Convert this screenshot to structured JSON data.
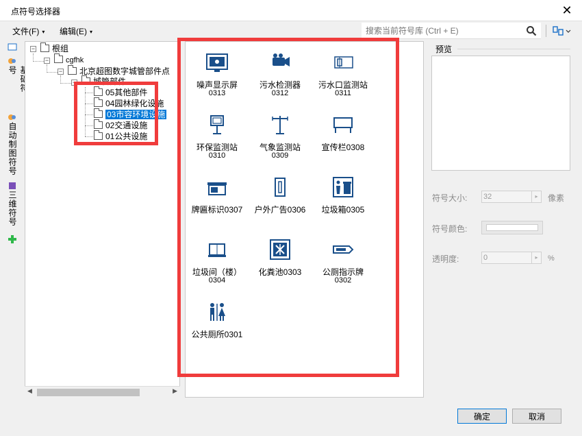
{
  "window": {
    "title": "点符号选择器",
    "close_glyph": "✕"
  },
  "menu": {
    "file": "文件(F)",
    "edit": "编辑(E)",
    "caret": "▾",
    "search_placeholder": "搜索当前符号库 (Ctrl + E)",
    "search_icon": "search-icon",
    "view_icon": "view-mode-icon"
  },
  "side_tabs": [
    {
      "label": "基础符号",
      "icon": "basic-symbol-icon"
    },
    {
      "label": "自动制图符号",
      "icon": "auto-mapping-icon"
    },
    {
      "label": "三维符号",
      "icon": "3d-symbol-icon"
    }
  ],
  "side_add_icon": "plus-icon",
  "tree": {
    "root": "根组",
    "level1": "cgfhk",
    "level2": "北京超图数字城管部件点",
    "level3": "城管部件",
    "children": [
      "05其他部件",
      "04园林绿化设施",
      "03市容环境设施",
      "02交通设施",
      "01公共设施"
    ],
    "selected_index": 2,
    "expander_minus": "−",
    "scroll_left": "◀",
    "scroll_right": "▶"
  },
  "symbols": [
    {
      "name": "噪声显示屏",
      "code": "0313",
      "icon": "noise-display-icon"
    },
    {
      "name": "污水检测器",
      "code": "0312",
      "icon": "sewage-detector-icon"
    },
    {
      "name": "污水口监测站",
      "code": "0311",
      "icon": "sewage-outlet-monitor-icon"
    },
    {
      "name": "环保监测站",
      "code": "0310",
      "icon": "env-monitor-station-icon"
    },
    {
      "name": "气象监测站",
      "code": "0309",
      "icon": "weather-station-icon"
    },
    {
      "name": "宣传栏0308",
      "code": "",
      "icon": "bulletin-board-icon"
    },
    {
      "name": "牌匾标识0307",
      "code": "",
      "icon": "signboard-icon"
    },
    {
      "name": "户外广告0306",
      "code": "",
      "icon": "outdoor-ad-icon"
    },
    {
      "name": "垃圾箱0305",
      "code": "",
      "icon": "trash-bin-icon"
    },
    {
      "name": "垃圾间（楼）",
      "code": "0304",
      "icon": "garbage-room-icon"
    },
    {
      "name": "化粪池0303",
      "code": "",
      "icon": "septic-tank-icon"
    },
    {
      "name": "公厕指示牌",
      "code": "0302",
      "icon": "toilet-sign-icon"
    },
    {
      "name": "公共厕所0301",
      "code": "",
      "icon": "public-toilet-icon"
    }
  ],
  "preview": {
    "label": "预览"
  },
  "props": {
    "size_label": "符号大小:",
    "size_value": "32",
    "size_unit": "像素",
    "color_label": "符号颜色:",
    "color_value": "#ffffff",
    "opacity_label": "透明度:",
    "opacity_value": "0",
    "opacity_unit": "%",
    "spin_glyph": "▸"
  },
  "buttons": {
    "ok": "确定",
    "cancel": "取消"
  },
  "colors": {
    "highlight": "#f03c3c",
    "selection": "#0078d7",
    "icon_blue": "#1a4f8a"
  }
}
